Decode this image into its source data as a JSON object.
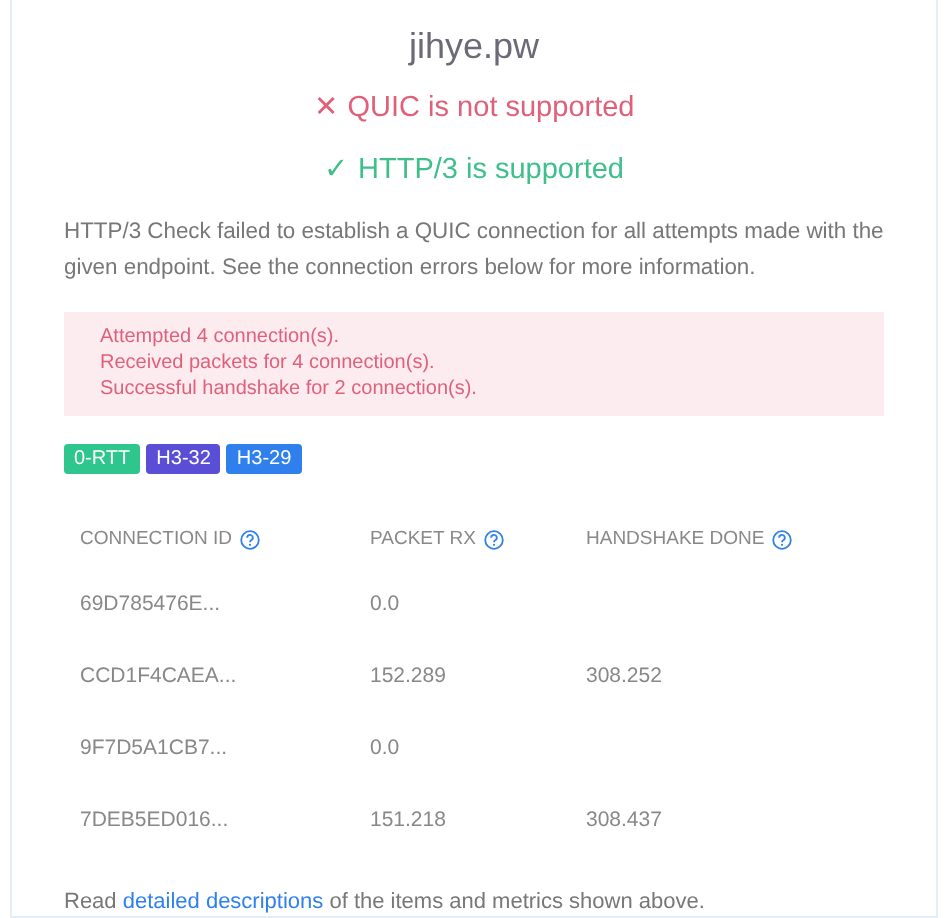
{
  "title": "jihye.pw",
  "statuses": [
    {
      "kind": "fail",
      "icon": "✕",
      "text": "QUIC is not supported"
    },
    {
      "kind": "pass",
      "icon": "✓",
      "text": "HTTP/3 is supported"
    }
  ],
  "description": "HTTP/3 Check failed to establish a QUIC connection for all attempts made with the given endpoint. See the connection errors below for more information.",
  "alert_lines": [
    "Attempted 4 connection(s).",
    "Received packets for 4 connection(s).",
    "Successful handshake for 2 connection(s)."
  ],
  "badges": [
    {
      "text": "0-RTT",
      "color": "#2ec68c"
    },
    {
      "text": "H3-32",
      "color": "#5b4ed6"
    },
    {
      "text": "H3-29",
      "color": "#2f80ed"
    }
  ],
  "table": {
    "columns": [
      "CONNECTION ID",
      "PACKET RX",
      "HANDSHAKE DONE"
    ],
    "rows": [
      [
        "69D785476E...",
        "0.0",
        ""
      ],
      [
        "CCD1F4CAEA...",
        "152.289",
        "308.252"
      ],
      [
        "9F7D5A1CB7...",
        "0.0",
        ""
      ],
      [
        "7DEB5ED016...",
        "151.218",
        "308.437"
      ]
    ]
  },
  "footer": {
    "before": "Read ",
    "link": "detailed descriptions",
    "after": " of the items and metrics shown above."
  }
}
